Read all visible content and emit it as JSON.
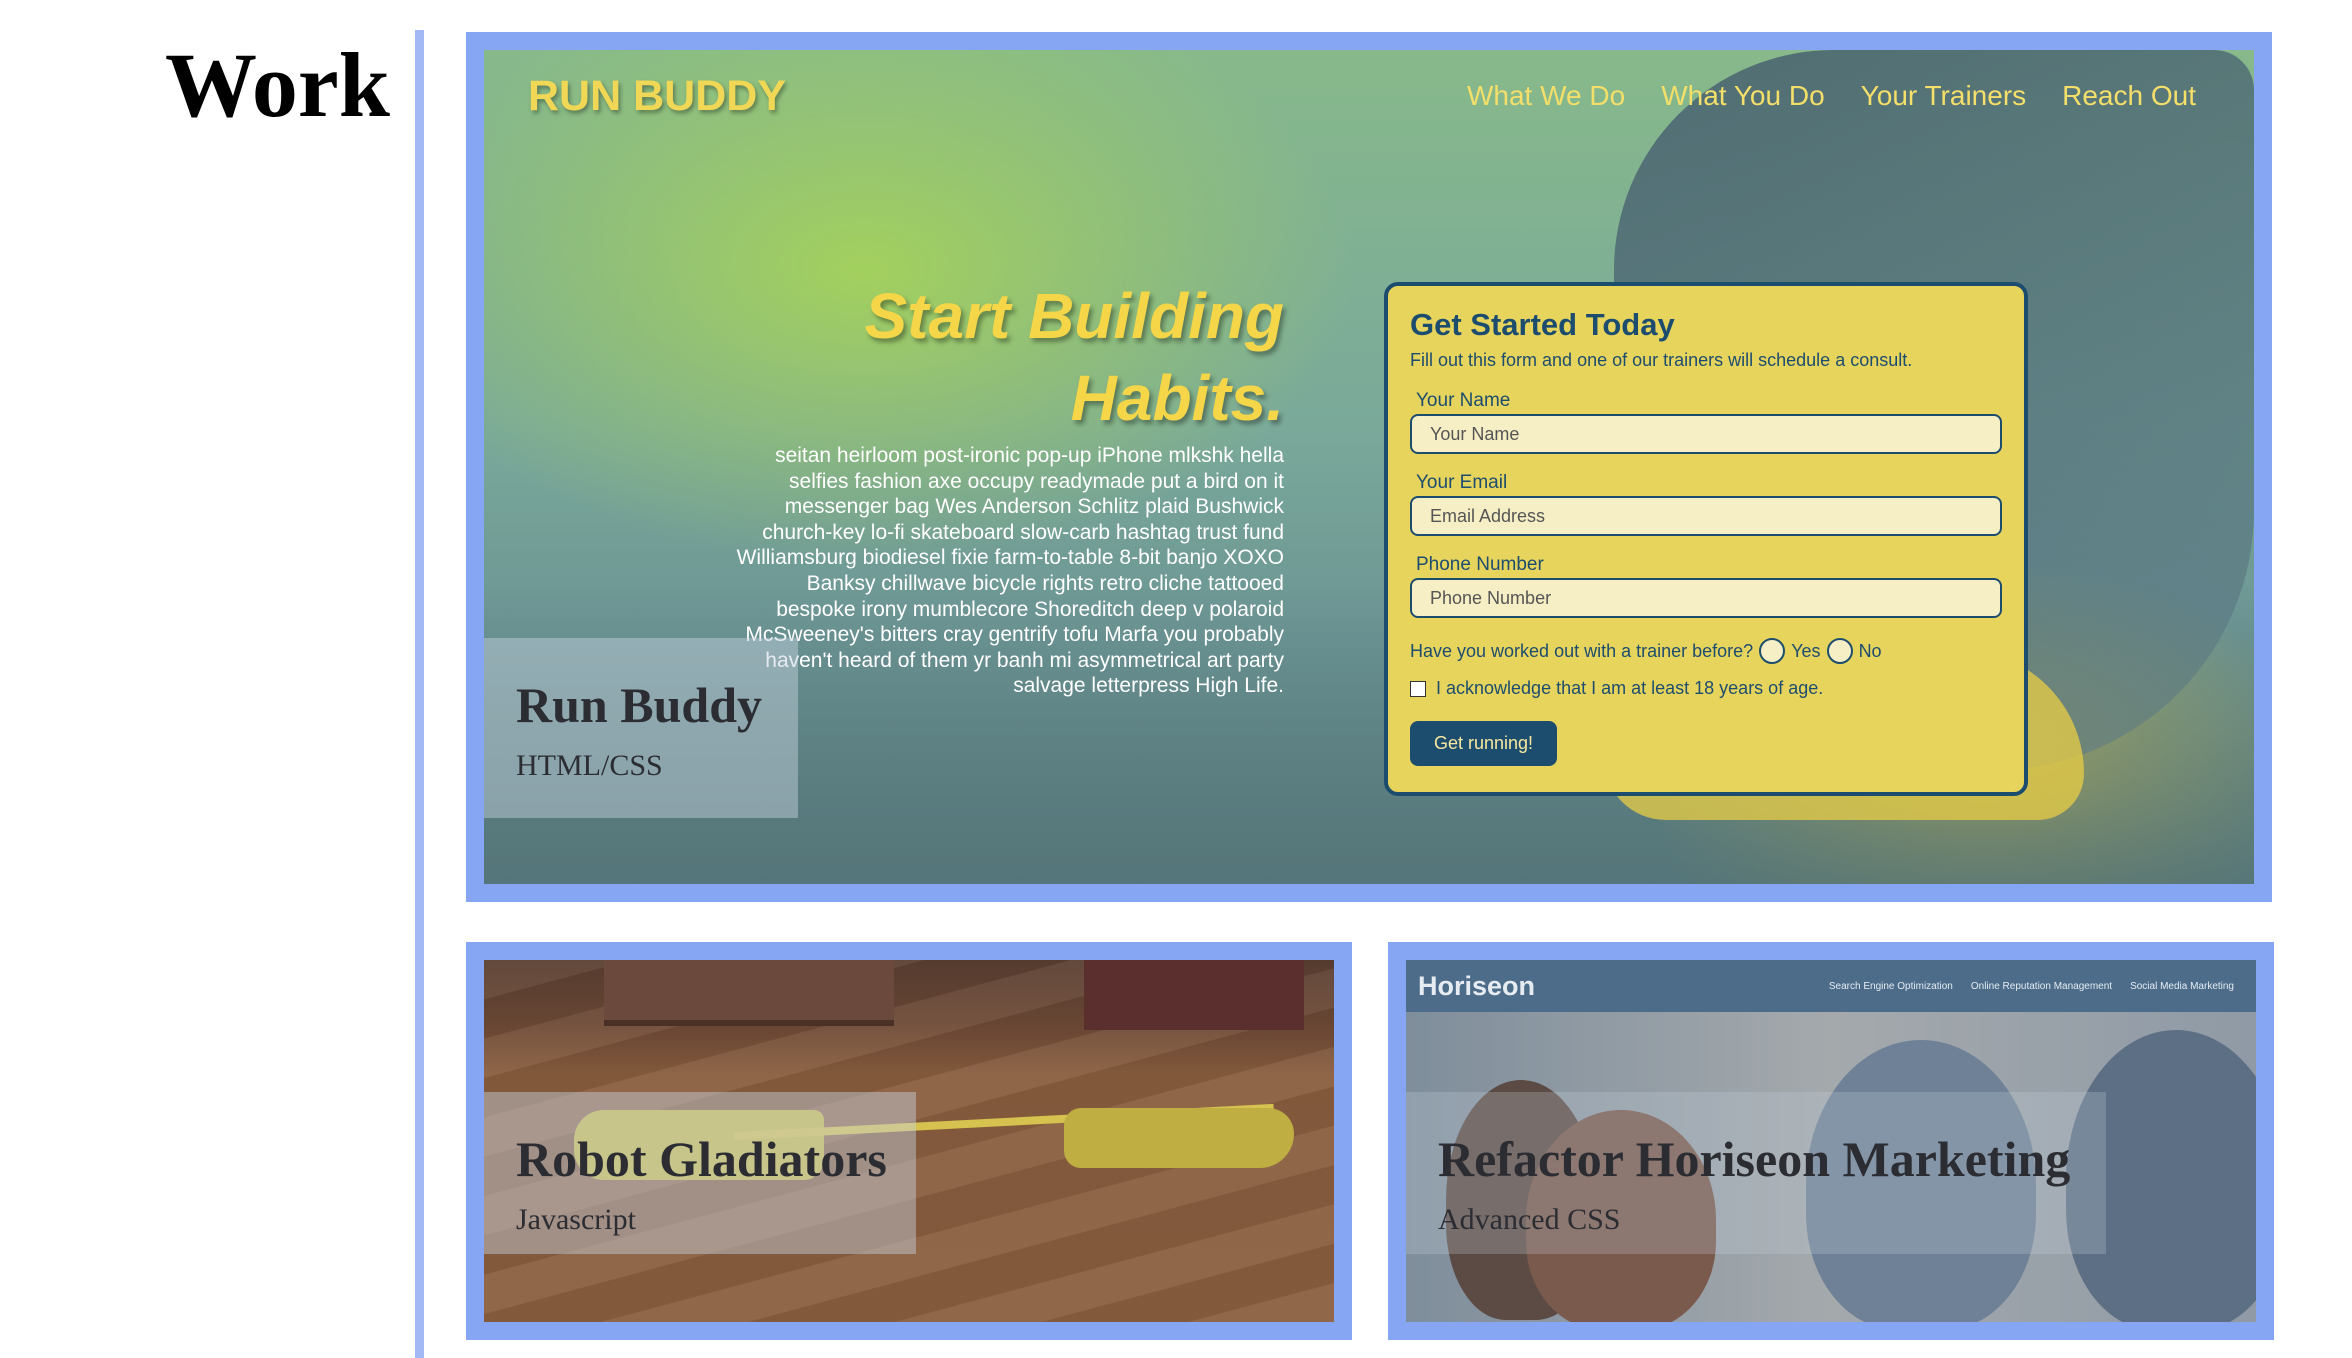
{
  "section": {
    "heading": "Work"
  },
  "projects": [
    {
      "title": "Run Buddy",
      "subtitle": "HTML/CSS"
    },
    {
      "title": "Robot Gladiators",
      "subtitle": "Javascript"
    },
    {
      "title": "Refactor Horiseon Marketing",
      "subtitle": "Advanced CSS"
    }
  ],
  "run_buddy_screenshot": {
    "logo": "RUN BUDDY",
    "nav": [
      "What We Do",
      "What You Do",
      "Your Trainers",
      "Reach Out"
    ],
    "hero_title_line1": "Start Building",
    "hero_title_line2": "Habits.",
    "hero_text": "seitan heirloom post-ironic pop-up iPhone mlkshk hella selfies fashion axe occupy readymade put a bird on it messenger bag Wes Anderson Schlitz plaid Bushwick church-key lo-fi skateboard slow-carb hashtag trust fund Williamsburg biodiesel fixie farm-to-table 8-bit banjo XOXO Banksy chillwave bicycle rights retro cliche tattooed bespoke irony mumblecore Shoreditch deep v polaroid McSweeney's bitters cray gentrify tofu Marfa you probably haven't heard of them yr banh mi asymmetrical art party salvage letterpress High Life.",
    "form": {
      "title": "Get Started Today",
      "subtitle": "Fill out this form and one of our trainers will schedule a consult.",
      "name_label": "Your Name",
      "name_placeholder": "Your Name",
      "email_label": "Your Email",
      "email_placeholder": "Email Address",
      "phone_label": "Phone Number",
      "phone_placeholder": "Phone Number",
      "question": "Have you worked out with a trainer before?",
      "yes_label": "Yes",
      "no_label": "No",
      "acknowledge": "I acknowledge that I am at least 18 years of age.",
      "submit_label": "Get running!"
    }
  },
  "horiseon_screenshot": {
    "logo": "Horiseon",
    "nav": [
      "Search Engine Optimization",
      "Online Reputation Management",
      "Social Media Marketing"
    ]
  },
  "colors": {
    "card_border": "#86a6f3",
    "divider": "#a3b9f5",
    "run_buddy_yellow": "#f4d648",
    "run_buddy_navy": "#1d4d6e"
  }
}
